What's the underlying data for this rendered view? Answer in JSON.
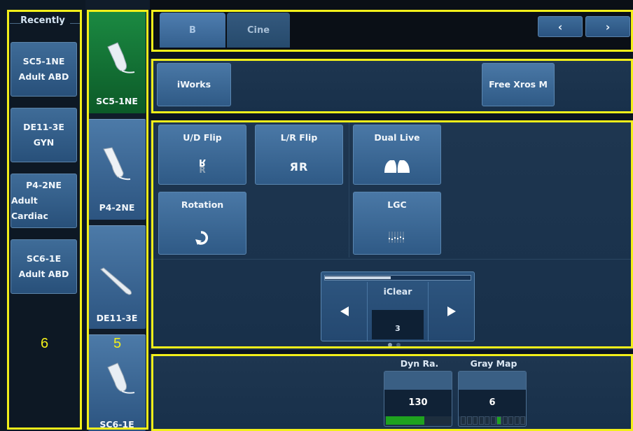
{
  "recently": {
    "title": "Recently",
    "items": [
      {
        "line1": "SC5-1NE",
        "line2": "Adult ABD"
      },
      {
        "line1": "DE11-3E",
        "line2": "GYN"
      },
      {
        "line1": "P4-2NE",
        "line2": "Adult Cardiac"
      },
      {
        "line1": "SC6-1E",
        "line2": "Adult ABD"
      }
    ]
  },
  "probes": [
    "SC5-1NE",
    "P4-2NE",
    "DE11-3E",
    "SC6-1E"
  ],
  "tabs": [
    "B",
    "Cine"
  ],
  "nav": {
    "prev": "‹",
    "next": "›"
  },
  "functions": {
    "iworks": "iWorks",
    "free_xros": "Free Xros M"
  },
  "image_controls": {
    "ud_flip": "U/D Flip",
    "lr_flip": "L/R Flip",
    "dual_live": "Dual Live",
    "rotation": "Rotation",
    "lgc": "LGC",
    "lr_flip_glyph": "ЯR",
    "ud_flip_glyph": "R"
  },
  "iclear": {
    "label": "iClear",
    "value": "3",
    "level": 0.45
  },
  "params": {
    "dyn_range": {
      "label": "Dyn Ra.",
      "value": "130",
      "level": 0.58
    },
    "gray_map": {
      "label": "Gray Map",
      "value": "6",
      "level": 0.62
    }
  },
  "annotations": {
    "left_panel": "6",
    "probe_panel": "5"
  },
  "colors": {
    "highlight": "#f2ef1a",
    "selected_probe": "#1b8a42",
    "button": "#3f6c98"
  }
}
